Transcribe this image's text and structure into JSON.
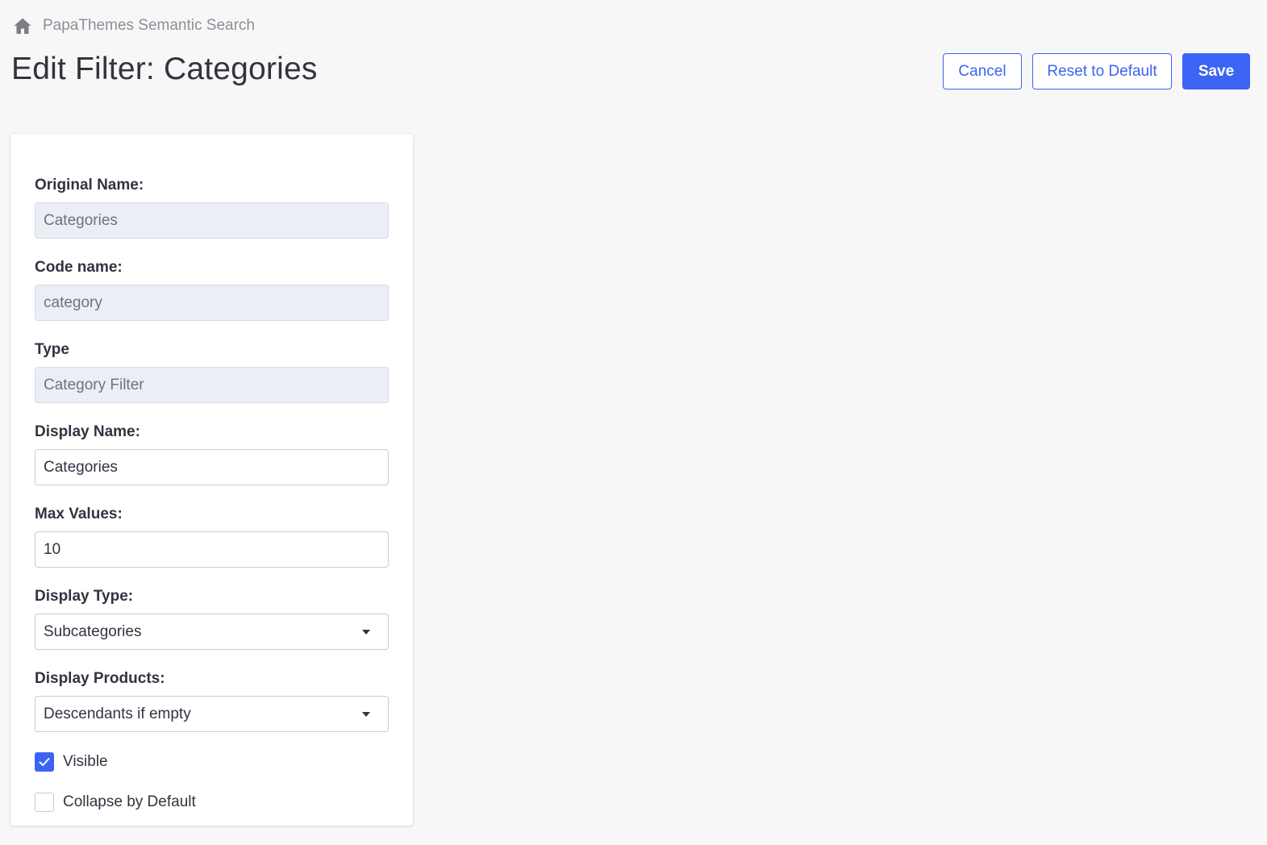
{
  "breadcrumb": {
    "icon": "home-icon",
    "label": "PapaThemes Semantic Search"
  },
  "page": {
    "title": "Edit Filter: Categories"
  },
  "actions": {
    "cancel_label": "Cancel",
    "reset_label": "Reset to Default",
    "save_label": "Save"
  },
  "form": {
    "original_name": {
      "label": "Original Name:",
      "value": "Categories"
    },
    "code_name": {
      "label": "Code name:",
      "value": "category"
    },
    "type": {
      "label": "Type",
      "value": "Category Filter"
    },
    "display_name": {
      "label": "Display Name:",
      "value": "Categories"
    },
    "max_values": {
      "label": "Max Values:",
      "value": "10"
    },
    "display_type": {
      "label": "Display Type:",
      "value": "Subcategories"
    },
    "display_products": {
      "label": "Display Products:",
      "value": "Descendants if empty"
    },
    "visible": {
      "label": "Visible",
      "checked": true
    },
    "collapse_by_default": {
      "label": "Collapse by Default",
      "checked": false
    }
  },
  "colors": {
    "accent": "#3c64f4",
    "background": "#f7f7f7",
    "disabled_field": "#ebeef5"
  }
}
